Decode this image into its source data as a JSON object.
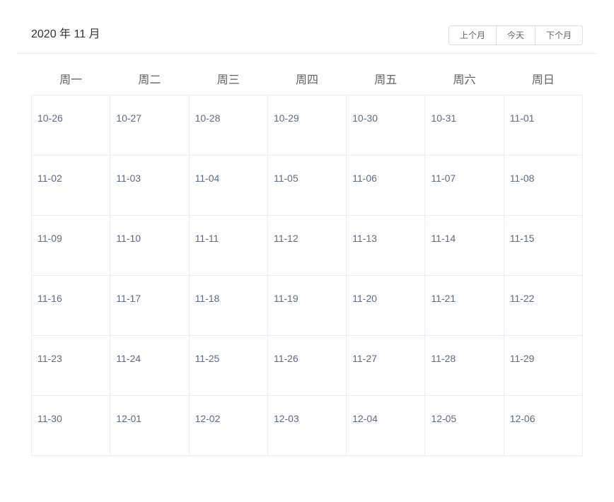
{
  "header": {
    "title": "2020 年 11 月",
    "prev_label": "上个月",
    "today_label": "今天",
    "next_label": "下个月"
  },
  "weekdays": [
    "周一",
    "周二",
    "周三",
    "周四",
    "周五",
    "周六",
    "周日"
  ],
  "weeks": [
    [
      "10-26",
      "10-27",
      "10-28",
      "10-29",
      "10-30",
      "10-31",
      "11-01"
    ],
    [
      "11-02",
      "11-03",
      "11-04",
      "11-05",
      "11-06",
      "11-07",
      "11-08"
    ],
    [
      "11-09",
      "11-10",
      "11-11",
      "11-12",
      "11-13",
      "11-14",
      "11-15"
    ],
    [
      "11-16",
      "11-17",
      "11-18",
      "11-19",
      "11-20",
      "11-21",
      "11-22"
    ],
    [
      "11-23",
      "11-24",
      "11-25",
      "11-26",
      "11-27",
      "11-28",
      "11-29"
    ],
    [
      "11-30",
      "12-01",
      "12-02",
      "12-03",
      "12-04",
      "12-05",
      "12-06"
    ]
  ],
  "colors": {
    "day_text": "#5c6b86",
    "border": "#ebeef5",
    "header_text": "#303133"
  }
}
